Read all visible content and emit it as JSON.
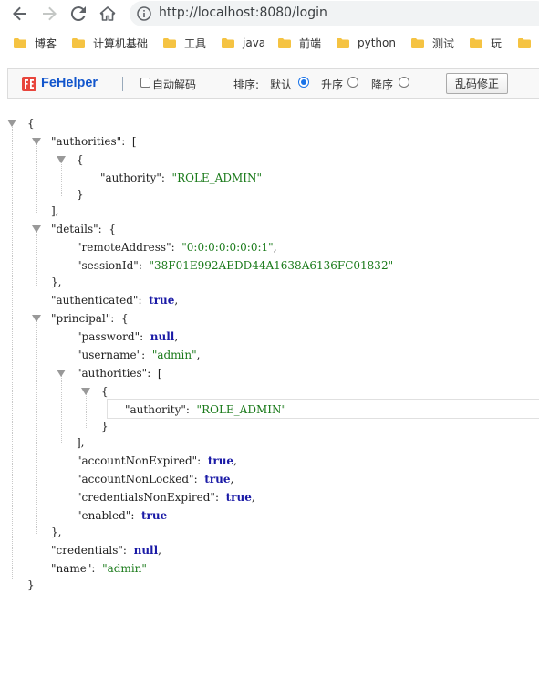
{
  "browser": {
    "url": "http://localhost:8080/login",
    "bookmarks": [
      "博客",
      "计算机基础",
      "工具",
      "java",
      "前端",
      "python",
      "测试",
      "玩"
    ]
  },
  "fehelper": {
    "brand": "FeHelper",
    "auto_decode_label": "自动解码",
    "sort_label": "排序:",
    "sort_default_label": "默认",
    "sort_asc_label": "升序",
    "sort_desc_label": "降序",
    "sort_selected": "默认",
    "fix_button_label": "乱码修正"
  },
  "json_view": {
    "l1": "{",
    "authorities_key": "\"authorities\"",
    "authority_key": "\"authority\"",
    "authority_value": "\"ROLE_ADMIN\"",
    "details_key": "\"details\"",
    "remote_key": "\"remoteAddress\"",
    "remote_value": "\"0:0:0:0:0:0:0:1\"",
    "session_key": "\"sessionId\"",
    "session_value": "\"38F01E992AEDD44A1638A6136FC01832\"",
    "authenticated_key": "\"authenticated\"",
    "authenticated_value": "true",
    "principal_key": "\"principal\"",
    "password_key": "\"password\"",
    "password_value": "null",
    "username_key": "\"username\"",
    "username_value": "\"admin\"",
    "p_authorities_key": "\"authorities\"",
    "p_authority_key": "\"authority\"",
    "p_authority_value": "\"ROLE_ADMIN\"",
    "acct_expired_key": "\"accountNonExpired\"",
    "acct_expired_value": "true",
    "acct_locked_key": "\"accountNonLocked\"",
    "acct_locked_value": "true",
    "cred_expired_key": "\"credentialsNonExpired\"",
    "cred_expired_value": "true",
    "enabled_key": "\"enabled\"",
    "enabled_value": "true",
    "credentials_key": "\"credentials\"",
    "credentials_value": "null",
    "name_key": "\"name\"",
    "name_value": "\"admin\"",
    "close": "}"
  },
  "colors": {
    "string": "#1a7a1a",
    "keyword": "#1a1aa6",
    "fehelper_brand": "#1155cc",
    "radio_selected": "#1a73e8"
  }
}
